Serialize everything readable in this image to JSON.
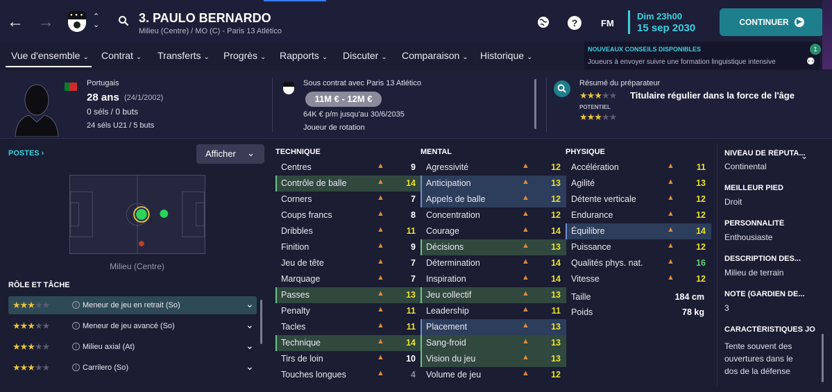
{
  "header": {
    "player_name": "3. PAULO BERNARDO",
    "player_subtitle": "Milieu (Centre) / MO (C) - Paris 13 Atlético",
    "fm_label": "FM",
    "date_day": "Dim 23h00",
    "date_full": "15 sep 2030",
    "continue_label": "CONTINUER"
  },
  "tabs": [
    {
      "label": "Vue d'ensemble"
    },
    {
      "label": "Contrat"
    },
    {
      "label": "Transferts"
    },
    {
      "label": "Progrès"
    },
    {
      "label": "Rapports"
    },
    {
      "label": "Discuter"
    },
    {
      "label": "Comparaison"
    },
    {
      "label": "Historique"
    }
  ],
  "notification": {
    "title": "NOUVEAUX CONSEILS DISPONIBLES",
    "body": "Joueurs à envoyer suivre une formation linguistique intensive",
    "count": "1"
  },
  "profile": {
    "nationality": "Portugais",
    "age": "28 ans",
    "birth": "(24/1/2002)",
    "caps": "0 séls / 0 buts",
    "u21": "24 séls U21 / 5 buts"
  },
  "contract": {
    "line": "Sous contrat avec Paris 13 Atlético",
    "value": "11M € - 12M €",
    "wage": "64K € p/m jusqu'au 30/6/2035",
    "status": "Joueur de rotation"
  },
  "scout": {
    "title": "Résumé du préparateur",
    "ability_stars": 3,
    "summary": "Titulaire régulier dans la force de l'âge",
    "potential_label": "POTENTIEL",
    "potential_stars": 3
  },
  "positions": {
    "title": "POSTES",
    "show_label": "Afficher",
    "position_label": "Milieu (Centre)"
  },
  "roles": {
    "title": "RÔLE ET TÂCHE",
    "items": [
      {
        "label": "Meneur de jeu en retrait (So)",
        "stars": 3
      },
      {
        "label": "Meneur de jeu avancé (So)",
        "stars": 3
      },
      {
        "label": "Milieu axial (At)",
        "stars": 3
      },
      {
        "label": "Carrilero (So)",
        "stars": 3
      }
    ]
  },
  "technique": {
    "title": "TECHNIQUE",
    "rows": [
      {
        "name": "Centres",
        "value": "9",
        "color": "white",
        "hl": ""
      },
      {
        "name": "Contrôle de balle",
        "value": "14",
        "color": "yellow",
        "hl": "hl"
      },
      {
        "name": "Corners",
        "value": "7",
        "color": "white",
        "hl": ""
      },
      {
        "name": "Coups francs",
        "value": "8",
        "color": "white",
        "hl": ""
      },
      {
        "name": "Dribbles",
        "value": "11",
        "color": "yellow",
        "hl": ""
      },
      {
        "name": "Finition",
        "value": "9",
        "color": "white",
        "hl": ""
      },
      {
        "name": "Jeu de tête",
        "value": "7",
        "color": "white",
        "hl": ""
      },
      {
        "name": "Marquage",
        "value": "7",
        "color": "white",
        "hl": ""
      },
      {
        "name": "Passes",
        "value": "13",
        "color": "yellow",
        "hl": "hl"
      },
      {
        "name": "Penalty",
        "value": "11",
        "color": "yellow",
        "hl": ""
      },
      {
        "name": "Tacles",
        "value": "11",
        "color": "yellow",
        "hl": ""
      },
      {
        "name": "Technique",
        "value": "14",
        "color": "yellow",
        "hl": "hl"
      },
      {
        "name": "Tirs de loin",
        "value": "10",
        "color": "white",
        "hl": ""
      },
      {
        "name": "Touches longues",
        "value": "4",
        "color": "grey",
        "hl": ""
      }
    ]
  },
  "mental": {
    "title": "MENTAL",
    "rows": [
      {
        "name": "Agressivité",
        "value": "12",
        "color": "yellow",
        "hl": ""
      },
      {
        "name": "Anticipation",
        "value": "13",
        "color": "yellow",
        "hl": "hlb"
      },
      {
        "name": "Appels de balle",
        "value": "12",
        "color": "yellow",
        "hl": "hlb"
      },
      {
        "name": "Concentration",
        "value": "12",
        "color": "yellow",
        "hl": ""
      },
      {
        "name": "Courage",
        "value": "14",
        "color": "yellow",
        "hl": ""
      },
      {
        "name": "Décisions",
        "value": "13",
        "color": "yellow",
        "hl": "hl"
      },
      {
        "name": "Détermination",
        "value": "14",
        "color": "yellow",
        "hl": ""
      },
      {
        "name": "Inspiration",
        "value": "14",
        "color": "yellow",
        "hl": ""
      },
      {
        "name": "Jeu collectif",
        "value": "13",
        "color": "yellow",
        "hl": "hl"
      },
      {
        "name": "Leadership",
        "value": "11",
        "color": "yellow",
        "hl": ""
      },
      {
        "name": "Placement",
        "value": "13",
        "color": "yellow",
        "hl": "hlb"
      },
      {
        "name": "Sang-froid",
        "value": "13",
        "color": "yellow",
        "hl": "hl"
      },
      {
        "name": "Vision du jeu",
        "value": "13",
        "color": "yellow",
        "hl": "hl"
      },
      {
        "name": "Volume de jeu",
        "value": "12",
        "color": "yellow",
        "hl": ""
      }
    ]
  },
  "physique": {
    "title": "PHYSIQUE",
    "rows": [
      {
        "name": "Accélération",
        "value": "11",
        "color": "yellow",
        "hl": ""
      },
      {
        "name": "Agilité",
        "value": "13",
        "color": "yellow",
        "hl": ""
      },
      {
        "name": "Détente verticale",
        "value": "12",
        "color": "yellow",
        "hl": ""
      },
      {
        "name": "Endurance",
        "value": "12",
        "color": "yellow",
        "hl": ""
      },
      {
        "name": "Équilibre",
        "value": "14",
        "color": "yellow",
        "hl": "hlb"
      },
      {
        "name": "Puissance",
        "value": "12",
        "color": "yellow",
        "hl": ""
      },
      {
        "name": "Qualités phys. nat.",
        "value": "16",
        "color": "green",
        "hl": ""
      },
      {
        "name": "Vitesse",
        "value": "12",
        "color": "yellow",
        "hl": ""
      }
    ],
    "height_label": "Taille",
    "height": "184 cm",
    "weight_label": "Poids",
    "weight": "78 kg"
  },
  "details": {
    "reputation_label": "NIVEAU DE RÉPUTA...",
    "reputation": "Continental",
    "foot_label": "MEILLEUR PIED",
    "foot": "Droit",
    "personality_label": "PERSONNALITÉ",
    "personality": "Enthousiaste",
    "desc_label": "DESCRIPTION DES...",
    "desc": "Milieu de terrain",
    "gk_label": "NOTE (GARDIEN DE...",
    "gk": "3",
    "traits_label": "CARACTÉRISTIQUES JO",
    "traits": "Tente souvent des ouvertures dans le dos de la défense"
  },
  "colors": {
    "accent_cyan": "#3dd0e0",
    "continue_teal": "#1e7f8c",
    "star": "#e8c33a",
    "value_yellow": "#e8e030",
    "value_green": "#5fd07a",
    "trend_orange": "#e08a3a"
  }
}
